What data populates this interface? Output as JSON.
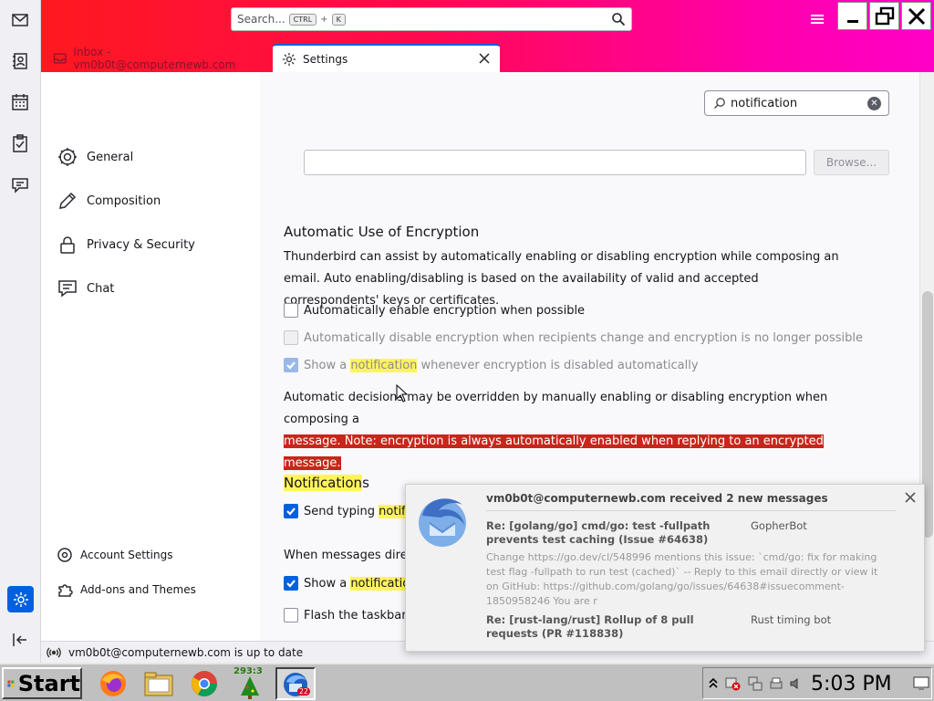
{
  "app": {
    "search_placeholder": "Search...",
    "search_key1": "CTRL",
    "search_plus": "+",
    "search_key2": "K"
  },
  "tabs": [
    {
      "label": "Inbox - vm0b0t@computernewb.com",
      "icon": "inbox-icon"
    },
    {
      "label": "Settings",
      "icon": "gear-icon",
      "active": true
    }
  ],
  "spaces": [
    "mail-icon",
    "address-book-icon",
    "calendar-icon",
    "tasks-icon",
    "chat-icon",
    "settings-icon",
    "collapse-icon"
  ],
  "nav": {
    "items": [
      {
        "label": "General",
        "icon": "gear-icon"
      },
      {
        "label": "Composition",
        "icon": "pencil-icon"
      },
      {
        "label": "Privacy & Security",
        "icon": "lock-icon"
      },
      {
        "label": "Chat",
        "icon": "chat-icon"
      }
    ],
    "account_settings": "Account Settings",
    "addons": "Add-ons and Themes"
  },
  "settings": {
    "filter_value": "notification",
    "browse_label": "Browse...",
    "encryption_heading": "Automatic Use of Encryption",
    "encryption_desc": "Thunderbird can assist by automatically enabling or disabling encryption while composing an email. Auto enabling/disabling is based on the availability of valid and accepted correspondents' keys or certificates.",
    "auto_enable": "Automatically enable encryption when possible",
    "auto_disable": "Automatically disable encryption when recipients change and encryption is no longer possible",
    "show_notif_pre": "Show a ",
    "show_notif_hl": "notification",
    "show_notif_post": " whenever encryption is disabled automatically",
    "override_line1": "Automatic decisions may be overridden by manually enabling or disabling encryption when composing a",
    "override_line2": "message. Note: encryption is always automatically enabled when replying to an encrypted message.",
    "notif_heading_hl": "Notification",
    "notif_heading_rest": "s",
    "typing_pre": "Send typing ",
    "typing_hl": "notifica",
    "when_msgs": "When messages direct",
    "show_a_pre": "Show a ",
    "show_a_hl": "notification",
    "flash": "Flash the taskbar ite"
  },
  "status": {
    "text": "vm0b0t@computernewb.com is up to date"
  },
  "toast": {
    "title": "vm0b0t@computernewb.com received 2 new messages",
    "msg1_subject": "Re: [golang/go] cmd/go: test -fullpath prevents test caching (Issue #64638)",
    "msg1_from": "GopherBot",
    "msg1_body": "Change https://go.dev/cl/548996 mentions this issue: `cmd/go: fix for making test flag -fullpath to run test (cached)` -- Reply to this email directly or view it on GitHub: https://github.com/golang/go/issues/64638#issuecomment-1850958246 You are r",
    "msg2_subject": "Re: [rust-lang/rust] Rollup of 8 pull requests (PR #118838)",
    "msg2_from": "Rust timing bot"
  },
  "taskbar": {
    "start": "Start",
    "counter": "293:3",
    "badge": "22",
    "clock": "5:03 PM"
  },
  "colors": {
    "accent": "#0060df",
    "titlebar_start": "#ff1a1a",
    "titlebar_end": "#ff00c8",
    "highlight": "#fff45a",
    "selection_red": "#c7261b"
  }
}
